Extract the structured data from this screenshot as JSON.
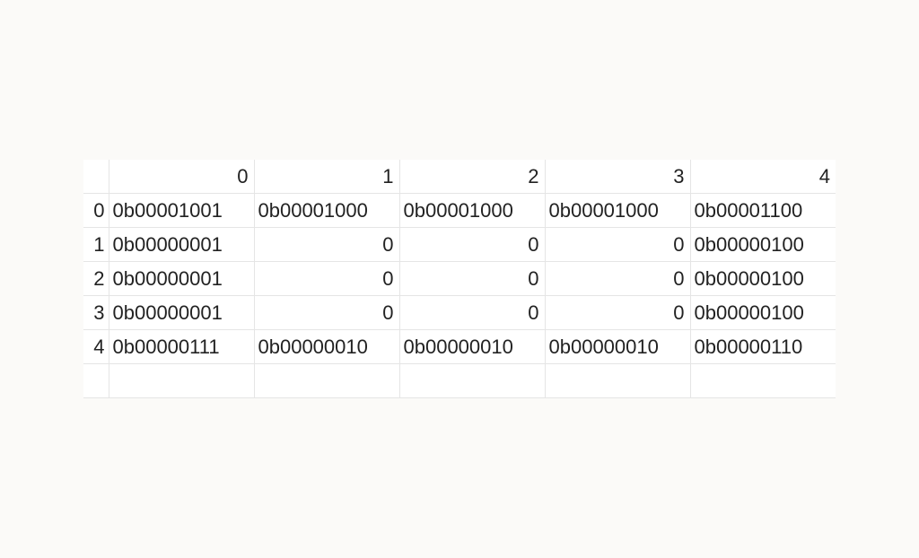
{
  "chart_data": {
    "type": "table",
    "columns": [
      "0",
      "1",
      "2",
      "3",
      "4"
    ],
    "row_labels": [
      "0",
      "1",
      "2",
      "3",
      "4"
    ],
    "rows": [
      [
        "0b00001001",
        "0b00001000",
        "0b00001000",
        "0b00001000",
        "0b00001100"
      ],
      [
        "0b00000001",
        "0",
        "0",
        "0",
        "0b00000100"
      ],
      [
        "0b00000001",
        "0",
        "0",
        "0",
        "0b00000100"
      ],
      [
        "0b00000001",
        "0",
        "0",
        "0",
        "0b00000100"
      ],
      [
        "0b00000111",
        "0b00000010",
        "0b00000010",
        "0b00000010",
        "0b00000110"
      ]
    ]
  }
}
